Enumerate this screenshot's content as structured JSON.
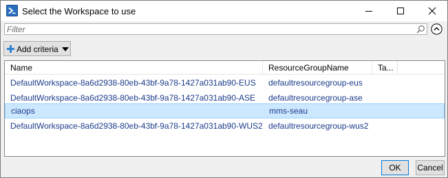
{
  "window": {
    "title": "Select the Workspace to use",
    "icon": "powershell-icon",
    "controls": [
      "minimize-icon",
      "maximize-icon",
      "close-icon"
    ]
  },
  "filter": {
    "placeholder": "Filter",
    "value": ""
  },
  "toolbar": {
    "add_criteria_label": "Add criteria"
  },
  "grid": {
    "columns": [
      "Name",
      "ResourceGroupName",
      "Ta...",
      ""
    ],
    "rows": [
      {
        "name": "DefaultWorkspace-8a6d2938-80eb-43bf-9a78-1427a031ab90-EUS",
        "resource_group": "defaultresourcegroup-eus",
        "tags": "",
        "selected": false
      },
      {
        "name": "DefaultWorkspace-8a6d2938-80eb-43bf-9a78-1427a031ab90-ASE",
        "resource_group": "defaultresourcegroup-ase",
        "tags": "",
        "selected": false
      },
      {
        "name": "ciaops",
        "resource_group": "mms-seau",
        "tags": "",
        "selected": true
      },
      {
        "name": "DefaultWorkspace-8a6d2938-80eb-43bf-9a78-1427a031ab90-WUS2",
        "resource_group": "defaultresourcegroup-wus2",
        "tags": "",
        "selected": false
      }
    ]
  },
  "buttons": {
    "ok_label": "OK",
    "cancel_label": "Cancel"
  },
  "colors": {
    "selection_bg": "#cce8ff",
    "cell_text": "#1a3b8a",
    "ok_border": "#0078d7"
  }
}
